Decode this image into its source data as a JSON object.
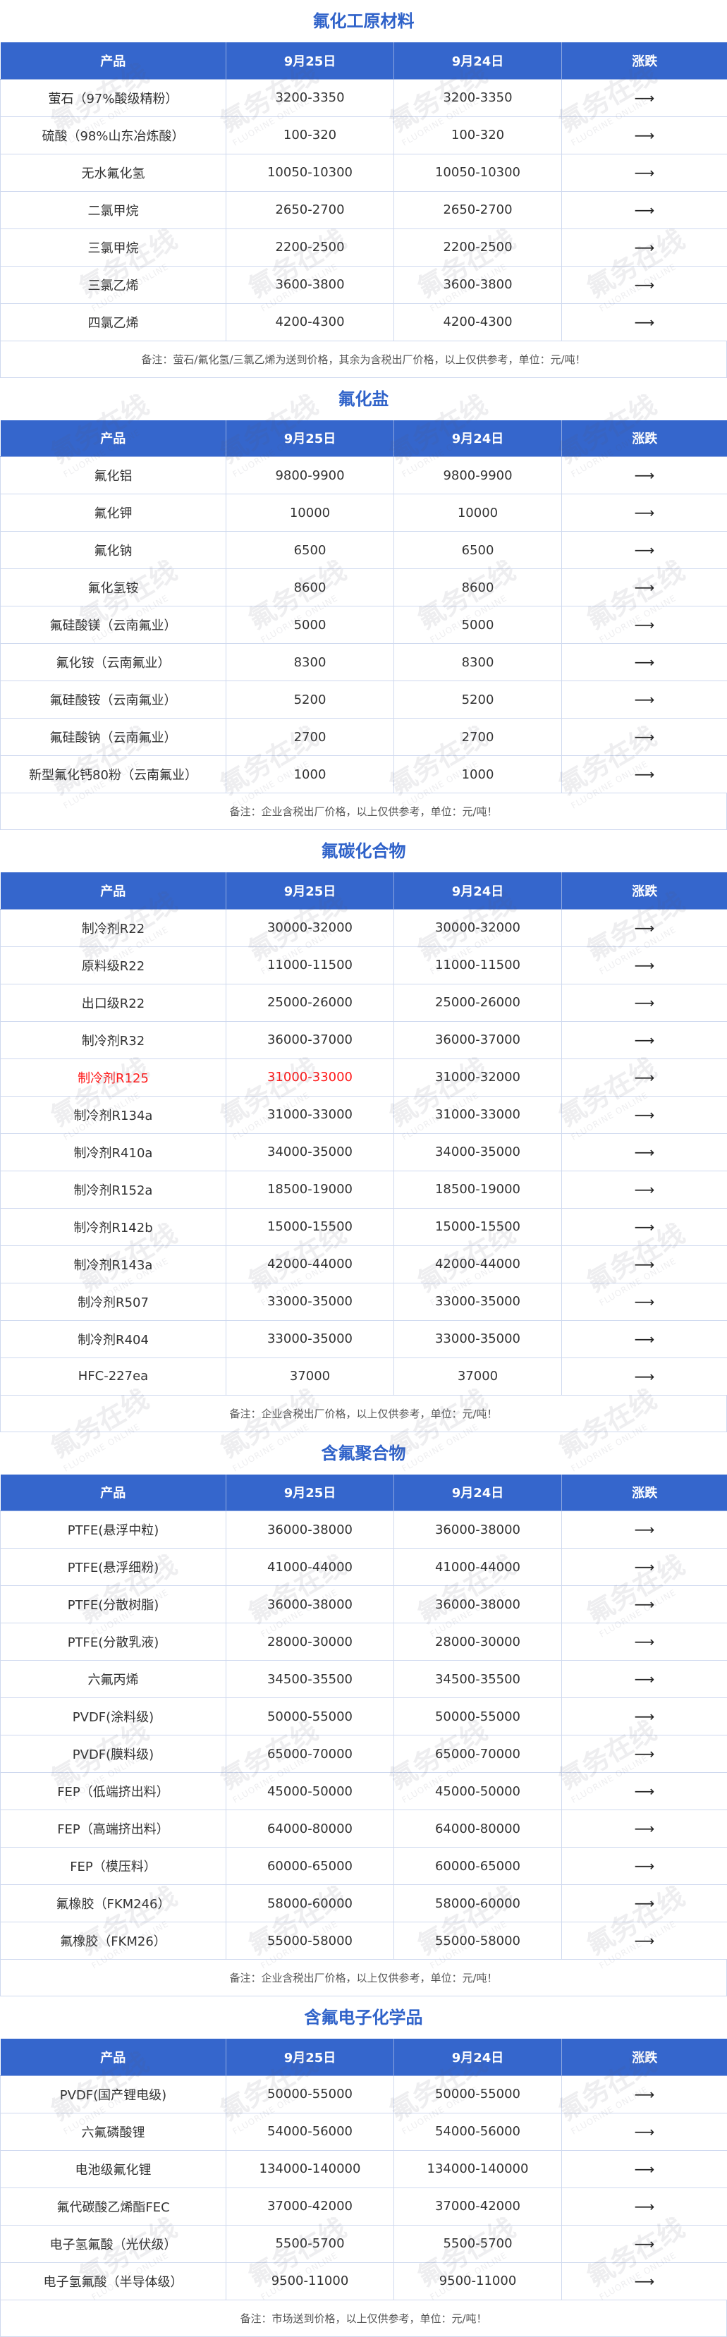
{
  "headers": [
    "产品",
    "9月25日",
    "9月24日",
    "涨跌"
  ],
  "trend_icon": "right-arrow-icon",
  "trend_glyph": "⟶",
  "highlight_color": "#ff1a1a",
  "accent_color": "#3566cc",
  "watermark": {
    "text": "氟务在线",
    "subtext": "FLUORINE ONLINE"
  },
  "sections": [
    {
      "title": "氟化工原材料",
      "note": "备注：萤石/氟化氢/三氯乙烯为送到价格，其余为含税出厂价格，以上仅供参考，单位：元/吨！",
      "rows": [
        {
          "name": "萤石（97%酸级精粉）",
          "d1": "3200-3350",
          "d2": "3200-3350",
          "trend": "⟶"
        },
        {
          "name": "硫酸（98%山东冶炼酸）",
          "d1": "100-320",
          "d2": "100-320",
          "trend": "⟶"
        },
        {
          "name": "无水氟化氢",
          "d1": "10050-10300",
          "d2": "10050-10300",
          "trend": "⟶"
        },
        {
          "name": "二氯甲烷",
          "d1": "2650-2700",
          "d2": "2650-2700",
          "trend": "⟶"
        },
        {
          "name": "三氯甲烷",
          "d1": "2200-2500",
          "d2": "2200-2500",
          "trend": "⟶"
        },
        {
          "name": "三氯乙烯",
          "d1": "3600-3800",
          "d2": "3600-3800",
          "trend": "⟶"
        },
        {
          "name": "四氯乙烯",
          "d1": "4200-4300",
          "d2": "4200-4300",
          "trend": "⟶"
        }
      ]
    },
    {
      "title": "氟化盐",
      "note": "备注：企业含税出厂价格，以上仅供参考，单位：元/吨！",
      "rows": [
        {
          "name": "氟化铝",
          "d1": "9800-9900",
          "d2": "9800-9900",
          "trend": "⟶"
        },
        {
          "name": "氟化钾",
          "d1": "10000",
          "d2": "10000",
          "trend": "⟶"
        },
        {
          "name": "氟化钠",
          "d1": "6500",
          "d2": "6500",
          "trend": "⟶"
        },
        {
          "name": "氟化氢铵",
          "d1": "8600",
          "d2": "8600",
          "trend": "⟶"
        },
        {
          "name": "氟硅酸镁（云南氟业）",
          "d1": "5000",
          "d2": "5000",
          "trend": "⟶"
        },
        {
          "name": "氟化铵（云南氟业）",
          "d1": "8300",
          "d2": "8300",
          "trend": "⟶"
        },
        {
          "name": "氟硅酸铵（云南氟业）",
          "d1": "5200",
          "d2": "5200",
          "trend": "⟶"
        },
        {
          "name": "氟硅酸钠（云南氟业）",
          "d1": "2700",
          "d2": "2700",
          "trend": "⟶"
        },
        {
          "name": "新型氟化钙80粉（云南氟业）",
          "d1": "1000",
          "d2": "1000",
          "trend": "⟶"
        }
      ]
    },
    {
      "title": "氟碳化合物",
      "note": "备注：企业含税出厂价格，以上仅供参考，单位：元/吨！",
      "rows": [
        {
          "name": "制冷剂R22",
          "d1": "30000-32000",
          "d2": "30000-32000",
          "trend": "⟶"
        },
        {
          "name": "原料级R22",
          "d1": "11000-11500",
          "d2": "11000-11500",
          "trend": "⟶"
        },
        {
          "name": "出口级R22",
          "d1": "25000-26000",
          "d2": "25000-26000",
          "trend": "⟶"
        },
        {
          "name": "制冷剂R32",
          "d1": "36000-37000",
          "d2": "36000-37000",
          "trend": "⟶"
        },
        {
          "name": "制冷剂R125",
          "d1": "31000-33000",
          "d2": "31000-32000",
          "trend": "⟶",
          "highlight": true
        },
        {
          "name": "制冷剂R134a",
          "d1": "31000-33000",
          "d2": "31000-33000",
          "trend": "⟶"
        },
        {
          "name": "制冷剂R410a",
          "d1": "34000-35000",
          "d2": "34000-35000",
          "trend": "⟶"
        },
        {
          "name": "制冷剂R152a",
          "d1": "18500-19000",
          "d2": "18500-19000",
          "trend": "⟶"
        },
        {
          "name": "制冷剂R142b",
          "d1": "15000-15500",
          "d2": "15000-15500",
          "trend": "⟶"
        },
        {
          "name": "制冷剂R143a",
          "d1": "42000-44000",
          "d2": "42000-44000",
          "trend": "⟶"
        },
        {
          "name": "制冷剂R507",
          "d1": "33000-35000",
          "d2": "33000-35000",
          "trend": "⟶"
        },
        {
          "name": "制冷剂R404",
          "d1": "33000-35000",
          "d2": "33000-35000",
          "trend": "⟶"
        },
        {
          "name": "HFC-227ea",
          "d1": "37000",
          "d2": "37000",
          "trend": "⟶"
        }
      ]
    },
    {
      "title": "含氟聚合物",
      "note": "备注：企业含税出厂价格，以上仅供参考，单位：元/吨！",
      "rows": [
        {
          "name": "PTFE(悬浮中粒)",
          "d1": "36000-38000",
          "d2": "36000-38000",
          "trend": "⟶"
        },
        {
          "name": "PTFE(悬浮细粉)",
          "d1": "41000-44000",
          "d2": "41000-44000",
          "trend": "⟶"
        },
        {
          "name": "PTFE(分散树脂)",
          "d1": "36000-38000",
          "d2": "36000-38000",
          "trend": "⟶"
        },
        {
          "name": "PTFE(分散乳液)",
          "d1": "28000-30000",
          "d2": "28000-30000",
          "trend": "⟶"
        },
        {
          "name": "六氟丙烯",
          "d1": "34500-35500",
          "d2": "34500-35500",
          "trend": "⟶"
        },
        {
          "name": "PVDF(涂料级)",
          "d1": "50000-55000",
          "d2": "50000-55000",
          "trend": "⟶"
        },
        {
          "name": "PVDF(膜料级)",
          "d1": "65000-70000",
          "d2": "65000-70000",
          "trend": "⟶"
        },
        {
          "name": "FEP（低端挤出料）",
          "d1": "45000-50000",
          "d2": "45000-50000",
          "trend": "⟶"
        },
        {
          "name": "FEP（高端挤出料）",
          "d1": "64000-80000",
          "d2": "64000-80000",
          "trend": "⟶"
        },
        {
          "name": "FEP（模压料）",
          "d1": "60000-65000",
          "d2": "60000-65000",
          "trend": "⟶"
        },
        {
          "name": "氟橡胶（FKM246）",
          "d1": "58000-60000",
          "d2": "58000-60000",
          "trend": "⟶"
        },
        {
          "name": "氟橡胶（FKM26）",
          "d1": "55000-58000",
          "d2": "55000-58000",
          "trend": "⟶"
        }
      ]
    },
    {
      "title": "含氟电子化学品",
      "note": "备注：市场送到价格，以上仅供参考，单位：元/吨！",
      "rows": [
        {
          "name": "PVDF(国产锂电级)",
          "d1": "50000-55000",
          "d2": "50000-55000",
          "trend": "⟶"
        },
        {
          "name": "六氟磷酸锂",
          "d1": "54000-56000",
          "d2": "54000-56000",
          "trend": "⟶"
        },
        {
          "name": "电池级氟化锂",
          "d1": "134000-140000",
          "d2": "134000-140000",
          "trend": "⟶"
        },
        {
          "name": "氟代碳酸乙烯酯FEC",
          "d1": "37000-42000",
          "d2": "37000-42000",
          "trend": "⟶"
        },
        {
          "name": "电子氢氟酸（光伏级）",
          "d1": "5500-5700",
          "d2": "5500-5700",
          "trend": "⟶"
        },
        {
          "name": "电子氢氟酸（半导体级）",
          "d1": "9500-11000",
          "d2": "9500-11000",
          "trend": "⟶"
        }
      ]
    }
  ]
}
